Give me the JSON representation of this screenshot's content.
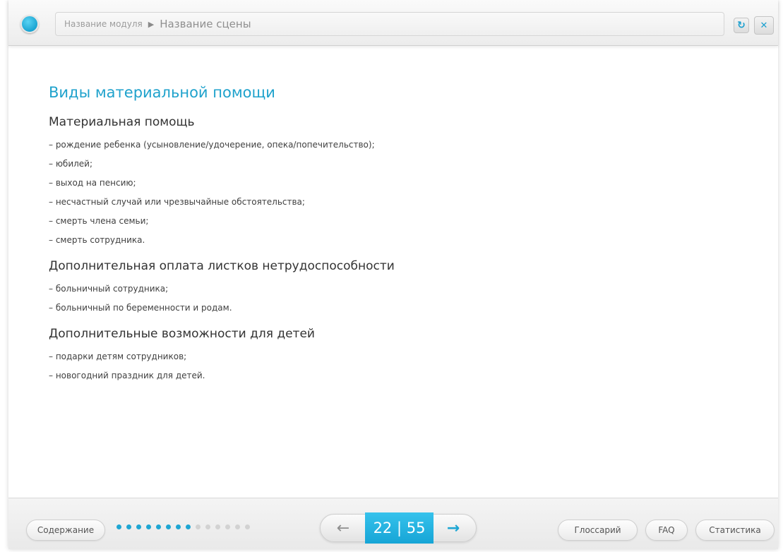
{
  "header": {
    "module_name": "Название модуля",
    "separator": "▶",
    "scene_name": "Название сцены",
    "refresh_icon": "refresh-icon",
    "close_icon": "close-icon"
  },
  "main": {
    "title": "Виды материальной помощи",
    "sections": [
      {
        "heading": "Материальная помощь",
        "items": [
          "– рождение ребенка (усыновление/удочерение, опека/попечительство);",
          "– юбилей;",
          "– выход на пенсию;",
          "– несчастный случай или чрезвычайные обстоятельства;",
          "– смерть члена семьи;",
          "– смерть сотрудника."
        ]
      },
      {
        "heading": "Дополнительная оплата листков нетрудоспособности",
        "items": [
          "– больничный сотрудника;",
          "– больничный по беременности и родам."
        ]
      },
      {
        "heading": "Дополнительные возможности для детей",
        "items": [
          "– подарки детям сотрудников;",
          "– новогодний праздник для детей."
        ]
      }
    ]
  },
  "footer": {
    "contents_label": "Содержание",
    "progress": {
      "completed_dots": 8,
      "total_dots": 14
    },
    "prev_arrow": "←",
    "next_arrow": "→",
    "counter": "22 | 55",
    "glossary_label": "Глоссарий",
    "faq_label": "FAQ",
    "stats_label": "Статистика"
  },
  "colors": {
    "accent": "#1ea6d3",
    "title": "#1fa2cc",
    "text": "#404040"
  }
}
